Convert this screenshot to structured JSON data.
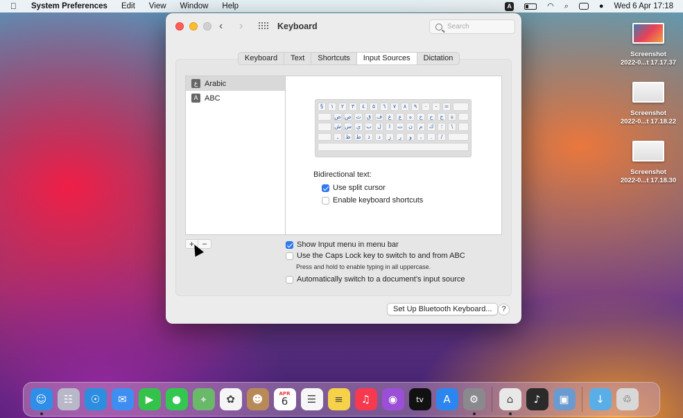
{
  "menubar": {
    "app_name": "System Preferences",
    "menus": [
      "Edit",
      "View",
      "Window",
      "Help"
    ],
    "input_badge": "A",
    "datetime": "Wed 6 Apr  17:18"
  },
  "desktop": {
    "files": [
      {
        "name": "Screenshot",
        "date": "2022-0...t 17.17.37"
      },
      {
        "name": "Screenshot",
        "date": "2022-0...t 17.18.22"
      },
      {
        "name": "Screenshot",
        "date": "2022-0...t 17.18.30"
      }
    ]
  },
  "window": {
    "title": "Keyboard",
    "search_placeholder": "Search",
    "tabs": [
      "Keyboard",
      "Text",
      "Shortcuts",
      "Input Sources",
      "Dictation"
    ],
    "active_tab": "Input Sources"
  },
  "sources": [
    {
      "icon": "ع",
      "label": "Arabic",
      "selected": true
    },
    {
      "icon": "A",
      "label": "ABC",
      "selected": false
    }
  ],
  "keyboard_rows": [
    [
      "§",
      "١",
      "٢",
      "٣",
      "٤",
      "٥",
      "٦",
      "٧",
      "٨",
      "٩",
      "٠",
      "-",
      "="
    ],
    [
      "ض",
      "ص",
      "ث",
      "ق",
      "ف",
      "غ",
      "ع",
      "ه",
      "خ",
      "ح",
      "ج",
      "ة"
    ],
    [
      "ش",
      "س",
      "ي",
      "ب",
      "ل",
      "ا",
      "ت",
      "ن",
      "م",
      "ك",
      "؛",
      "\\"
    ],
    [
      "ـ",
      "ظ",
      "ط",
      "ذ",
      "د",
      "ز",
      "ر",
      "و",
      "،",
      ".",
      "/"
    ]
  ],
  "bidi": {
    "label": "Bidirectional text:",
    "split_cursor": {
      "label": "Use split cursor",
      "checked": true
    },
    "kbd_shortcuts": {
      "label": "Enable keyboard shortcuts",
      "checked": false
    }
  },
  "options": {
    "show_input_menu": {
      "label": "Show Input menu in menu bar",
      "checked": true
    },
    "caps_lock": {
      "label": "Use the Caps Lock key to switch to and from ABC",
      "checked": false
    },
    "caps_hint": "Press and hold to enable typing in all uppercase.",
    "auto_switch": {
      "label": "Automatically switch to a document’s input source",
      "checked": false
    }
  },
  "list_controls": {
    "add": "+",
    "remove": "−"
  },
  "buttons": {
    "bluetooth": "Set Up Bluetooth Keyboard...",
    "help": "?"
  },
  "calendar": {
    "month": "APR",
    "day": "6"
  },
  "dock_apps": [
    {
      "name": "finder",
      "color": "#2f8fe8"
    },
    {
      "name": "launchpad",
      "color": "#b8b8c8"
    },
    {
      "name": "safari",
      "color": "#2d8ee0"
    },
    {
      "name": "mail",
      "color": "#3d8ef0"
    },
    {
      "name": "facetime",
      "color": "#34c24a"
    },
    {
      "name": "messages",
      "color": "#33c74f"
    },
    {
      "name": "maps",
      "color": "#6ab86a"
    },
    {
      "name": "photos",
      "color": "#f5f5f5"
    },
    {
      "name": "contacts",
      "color": "#b88a58"
    },
    {
      "name": "calendar",
      "color": "#ffffff"
    },
    {
      "name": "reminders",
      "color": "#f6f6f6"
    },
    {
      "name": "notes",
      "color": "#f5d24a"
    },
    {
      "name": "music",
      "color": "#f6394e"
    },
    {
      "name": "podcasts",
      "color": "#9b4fd6"
    },
    {
      "name": "tv",
      "color": "#111111"
    },
    {
      "name": "app-store",
      "color": "#2d86f0"
    },
    {
      "name": "system-preferences",
      "color": "#8a8a8e"
    },
    {
      "name": "usb-prober",
      "color": "#e8e8e8"
    },
    {
      "name": "piano",
      "color": "#2a2a2a"
    },
    {
      "name": "preview",
      "color": "#6a9ad0"
    },
    {
      "name": "downloads",
      "color": "#5aaee8"
    },
    {
      "name": "trash",
      "color": "#d8d8d8"
    }
  ]
}
